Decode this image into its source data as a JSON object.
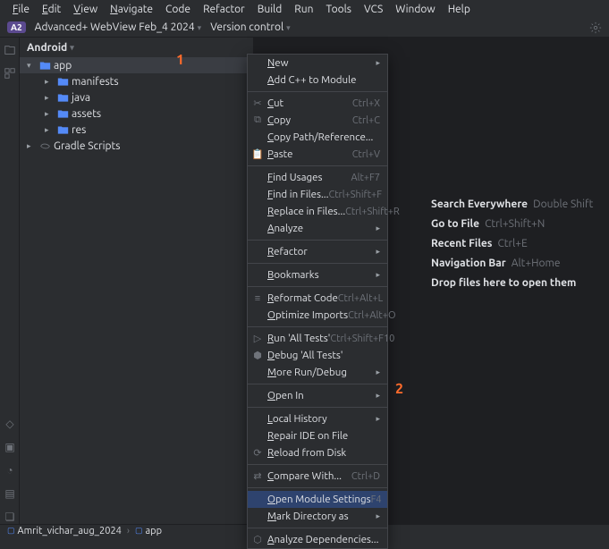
{
  "menubar": [
    "File",
    "Edit",
    "View",
    "Navigate",
    "Code",
    "Refactor",
    "Build",
    "Run",
    "Tools",
    "VCS",
    "Window",
    "Help"
  ],
  "toolbar": {
    "project_badge": "A2",
    "project_name": "Advanced+ WebView Feb_4 2024",
    "version_control": "Version control"
  },
  "sidebar": {
    "header": "Android",
    "tree": [
      {
        "label": "app",
        "expanded": true,
        "selected": true,
        "depth": 1,
        "icon": "folder"
      },
      {
        "label": "manifests",
        "depth": 2,
        "icon": "folder",
        "arrow": true
      },
      {
        "label": "java",
        "depth": 2,
        "icon": "folder",
        "arrow": true
      },
      {
        "label": "assets",
        "depth": 2,
        "icon": "folder",
        "arrow": true
      },
      {
        "label": "res",
        "depth": 2,
        "icon": "folder",
        "arrow": true
      },
      {
        "label": "Gradle Scripts",
        "depth": 1,
        "icon": "gradle",
        "arrow": true
      }
    ]
  },
  "editor_hints": [
    {
      "title": "Search Everywhere",
      "shortcut": "Double Shift"
    },
    {
      "title": "Go to File",
      "shortcut": "Ctrl+Shift+N"
    },
    {
      "title": "Recent Files",
      "shortcut": "Ctrl+E"
    },
    {
      "title": "Navigation Bar",
      "shortcut": "Alt+Home"
    },
    {
      "title": "Drop files here to open them",
      "shortcut": ""
    }
  ],
  "context_menu": [
    {
      "type": "item",
      "label": "New",
      "submenu": true
    },
    {
      "type": "item",
      "label": "Add C++ to Module"
    },
    {
      "type": "sep"
    },
    {
      "type": "item",
      "label": "Cut",
      "shortcut": "Ctrl+X",
      "icon": "cut"
    },
    {
      "type": "item",
      "label": "Copy",
      "shortcut": "Ctrl+C",
      "icon": "copy"
    },
    {
      "type": "item",
      "label": "Copy Path/Reference..."
    },
    {
      "type": "item",
      "label": "Paste",
      "shortcut": "Ctrl+V",
      "icon": "paste"
    },
    {
      "type": "sep"
    },
    {
      "type": "item",
      "label": "Find Usages",
      "shortcut": "Alt+F7"
    },
    {
      "type": "item",
      "label": "Find in Files...",
      "shortcut": "Ctrl+Shift+F"
    },
    {
      "type": "item",
      "label": "Replace in Files...",
      "shortcut": "Ctrl+Shift+R"
    },
    {
      "type": "item",
      "label": "Analyze",
      "submenu": true
    },
    {
      "type": "sep"
    },
    {
      "type": "item",
      "label": "Refactor",
      "submenu": true
    },
    {
      "type": "sep"
    },
    {
      "type": "item",
      "label": "Bookmarks",
      "submenu": true
    },
    {
      "type": "sep"
    },
    {
      "type": "item",
      "label": "Reformat Code",
      "shortcut": "Ctrl+Alt+L",
      "icon": "reformat"
    },
    {
      "type": "item",
      "label": "Optimize Imports",
      "shortcut": "Ctrl+Alt+O"
    },
    {
      "type": "sep"
    },
    {
      "type": "item",
      "label": "Run 'All Tests'",
      "shortcut": "Ctrl+Shift+F10",
      "icon": "run"
    },
    {
      "type": "item",
      "label": "Debug 'All Tests'",
      "icon": "debug"
    },
    {
      "type": "item",
      "label": "More Run/Debug",
      "submenu": true
    },
    {
      "type": "sep"
    },
    {
      "type": "item",
      "label": "Open In",
      "submenu": true
    },
    {
      "type": "sep"
    },
    {
      "type": "item",
      "label": "Local History",
      "submenu": true
    },
    {
      "type": "item",
      "label": "Repair IDE on File"
    },
    {
      "type": "item",
      "label": "Reload from Disk",
      "icon": "reload"
    },
    {
      "type": "sep"
    },
    {
      "type": "item",
      "label": "Compare With...",
      "shortcut": "Ctrl+D",
      "icon": "compare"
    },
    {
      "type": "sep"
    },
    {
      "type": "item",
      "label": "Open Module Settings",
      "shortcut": "F4",
      "highlight": true
    },
    {
      "type": "item",
      "label": "Mark Directory as",
      "submenu": true
    },
    {
      "type": "sep"
    },
    {
      "type": "item",
      "label": "Analyze Dependencies...",
      "icon": "deps"
    }
  ],
  "statusbar": {
    "bc1": "Amrit_vichar_aug_2024",
    "bc2": "app"
  },
  "callouts": {
    "c1": "1",
    "c2": "2"
  }
}
